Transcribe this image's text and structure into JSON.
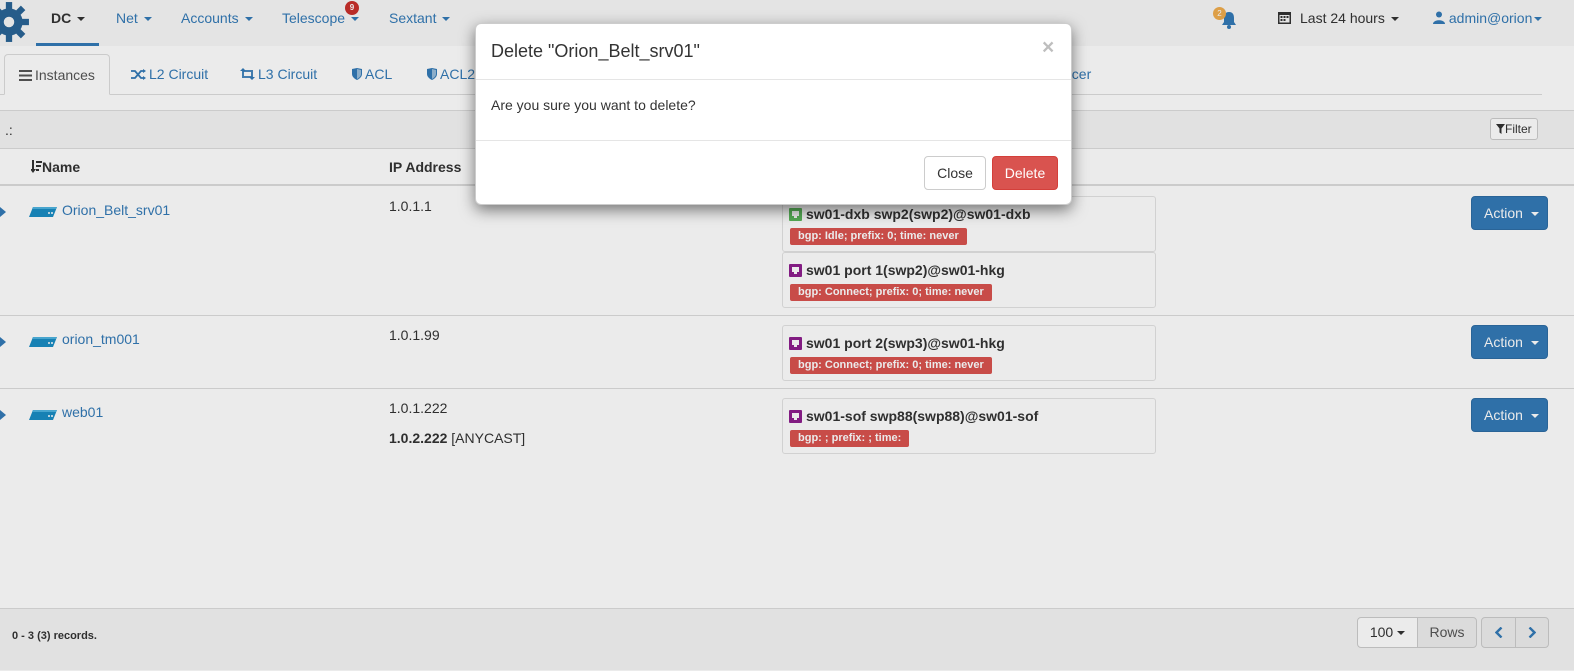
{
  "navbar": {
    "items": [
      {
        "label": "DC"
      },
      {
        "label": "Net"
      },
      {
        "label": "Accounts"
      },
      {
        "label": "Telescope",
        "badge": "9"
      },
      {
        "label": "Sextant"
      }
    ],
    "notifications_badge": "2",
    "time_range": "Last 24 hours",
    "user": "admin@orion"
  },
  "tabs": [
    {
      "label": "Instances"
    },
    {
      "label": "L2 Circuit"
    },
    {
      "label": "L3 Circuit"
    },
    {
      "label": "ACL"
    },
    {
      "label": "ACL2"
    },
    {
      "label": "ncer"
    }
  ],
  "panel": {
    "heading_text": ".:",
    "filter_label": "Filter",
    "columns": {
      "name": "Name",
      "ip": "IP Address"
    },
    "rows": [
      {
        "name": "Orion_Belt_srv01",
        "ips": [
          {
            "addr": "1.0.1.1",
            "suffix": ""
          }
        ],
        "interfaces": [
          {
            "title": "sw01-dxb swp2(swp2)@sw01-dxb",
            "bgp": "bgp: Idle; prefix: 0; time: never",
            "icon_color": "#5cb85c"
          },
          {
            "title": "sw01 port 1(swp2)@sw01-hkg",
            "bgp": "bgp: Connect; prefix: 0; time: never",
            "icon_color": "#8e1f8e"
          }
        ],
        "action_label": "Action"
      },
      {
        "name": "orion_tm001",
        "ips": [
          {
            "addr": "1.0.1.99",
            "suffix": ""
          }
        ],
        "interfaces": [
          {
            "title": "sw01 port 2(swp3)@sw01-hkg",
            "bgp": "bgp: Connect; prefix: 0; time: never",
            "icon_color": "#8e1f8e"
          }
        ],
        "action_label": "Action"
      },
      {
        "name": "web01",
        "ips": [
          {
            "addr": "1.0.1.222",
            "suffix": ""
          },
          {
            "addr": "1.0.2.222",
            "suffix": "[ANYCAST]"
          }
        ],
        "interfaces": [
          {
            "title": "sw01-sof swp88(swp88)@sw01-sof",
            "bgp": "bgp: ; prefix: ; time:",
            "icon_color": "#8e1f8e"
          }
        ],
        "action_label": "Action"
      }
    ],
    "footer": {
      "records": "0 - 3 (3) records.",
      "page_size": "100",
      "rows_label": "Rows"
    }
  },
  "modal": {
    "title": "Delete \"Orion_Belt_srv01\"",
    "close_symbol": "×",
    "body": "Are you sure you want to delete?",
    "close_label": "Close",
    "delete_label": "Delete"
  },
  "colors": {
    "link": "#337ab7",
    "danger": "#d9534f",
    "primary": "#337ab7"
  }
}
